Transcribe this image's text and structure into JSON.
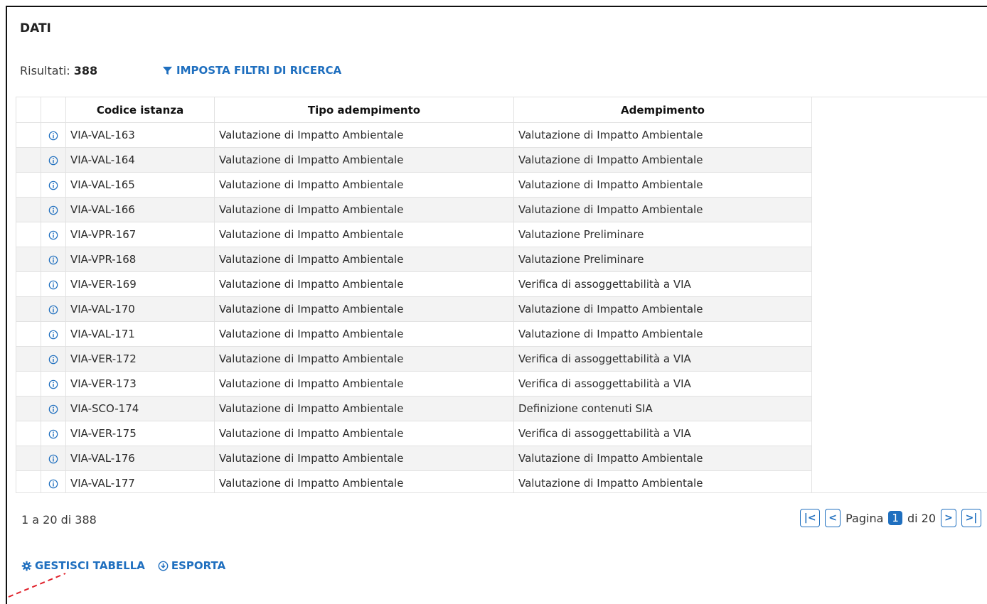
{
  "section": {
    "title": "DATI"
  },
  "results": {
    "label": "Risultati:",
    "count": "388"
  },
  "filters_link": {
    "label": "IMPOSTA FILTRI DI RICERCA",
    "icon": "filter-icon"
  },
  "table": {
    "headers": [
      "",
      "",
      "Codice istanza",
      "Tipo adempimento",
      "Adempimento"
    ],
    "rows": [
      {
        "codice": "VIA-VAL-163",
        "tipo": "Valutazione di Impatto Ambientale",
        "adempimento": "Valutazione di Impatto Ambientale"
      },
      {
        "codice": "VIA-VAL-164",
        "tipo": "Valutazione di Impatto Ambientale",
        "adempimento": "Valutazione di Impatto Ambientale"
      },
      {
        "codice": "VIA-VAL-165",
        "tipo": "Valutazione di Impatto Ambientale",
        "adempimento": "Valutazione di Impatto Ambientale"
      },
      {
        "codice": "VIA-VAL-166",
        "tipo": "Valutazione di Impatto Ambientale",
        "adempimento": "Valutazione di Impatto Ambientale"
      },
      {
        "codice": "VIA-VPR-167",
        "tipo": "Valutazione di Impatto Ambientale",
        "adempimento": "Valutazione Preliminare"
      },
      {
        "codice": "VIA-VPR-168",
        "tipo": "Valutazione di Impatto Ambientale",
        "adempimento": "Valutazione Preliminare"
      },
      {
        "codice": "VIA-VER-169",
        "tipo": "Valutazione di Impatto Ambientale",
        "adempimento": "Verifica di assoggettabilità a VIA"
      },
      {
        "codice": "VIA-VAL-170",
        "tipo": "Valutazione di Impatto Ambientale",
        "adempimento": "Valutazione di Impatto Ambientale"
      },
      {
        "codice": "VIA-VAL-171",
        "tipo": "Valutazione di Impatto Ambientale",
        "adempimento": "Valutazione di Impatto Ambientale"
      },
      {
        "codice": "VIA-VER-172",
        "tipo": "Valutazione di Impatto Ambientale",
        "adempimento": "Verifica di assoggettabilità a VIA"
      },
      {
        "codice": "VIA-VER-173",
        "tipo": "Valutazione di Impatto Ambientale",
        "adempimento": "Verifica di assoggettabilità a VIA"
      },
      {
        "codice": "VIA-SCO-174",
        "tipo": "Valutazione di Impatto Ambientale",
        "adempimento": "Definizione contenuti SIA"
      },
      {
        "codice": "VIA-VER-175",
        "tipo": "Valutazione di Impatto Ambientale",
        "adempimento": "Verifica di assoggettabilità a VIA"
      },
      {
        "codice": "VIA-VAL-176",
        "tipo": "Valutazione di Impatto Ambientale",
        "adempimento": "Valutazione di Impatto Ambientale"
      },
      {
        "codice": "VIA-VAL-177",
        "tipo": "Valutazione di Impatto Ambientale",
        "adempimento": "Valutazione di Impatto Ambientale"
      }
    ]
  },
  "pagination": {
    "range_text": "1 a 20 di 388",
    "first": "|<",
    "prev": "<",
    "page_label": "Pagina",
    "current": "1",
    "of_label": "di 20",
    "next": ">",
    "last": ">|"
  },
  "actions": {
    "manage_table": {
      "label": "GESTISCI TABELLA",
      "icon": "gear-icon"
    },
    "export": {
      "label": "ESPORTA",
      "icon": "download-circle-icon"
    }
  },
  "colors": {
    "accent": "#1f6fbf",
    "row_alt": "#f3f3f3",
    "annotation": "#e0202a"
  }
}
